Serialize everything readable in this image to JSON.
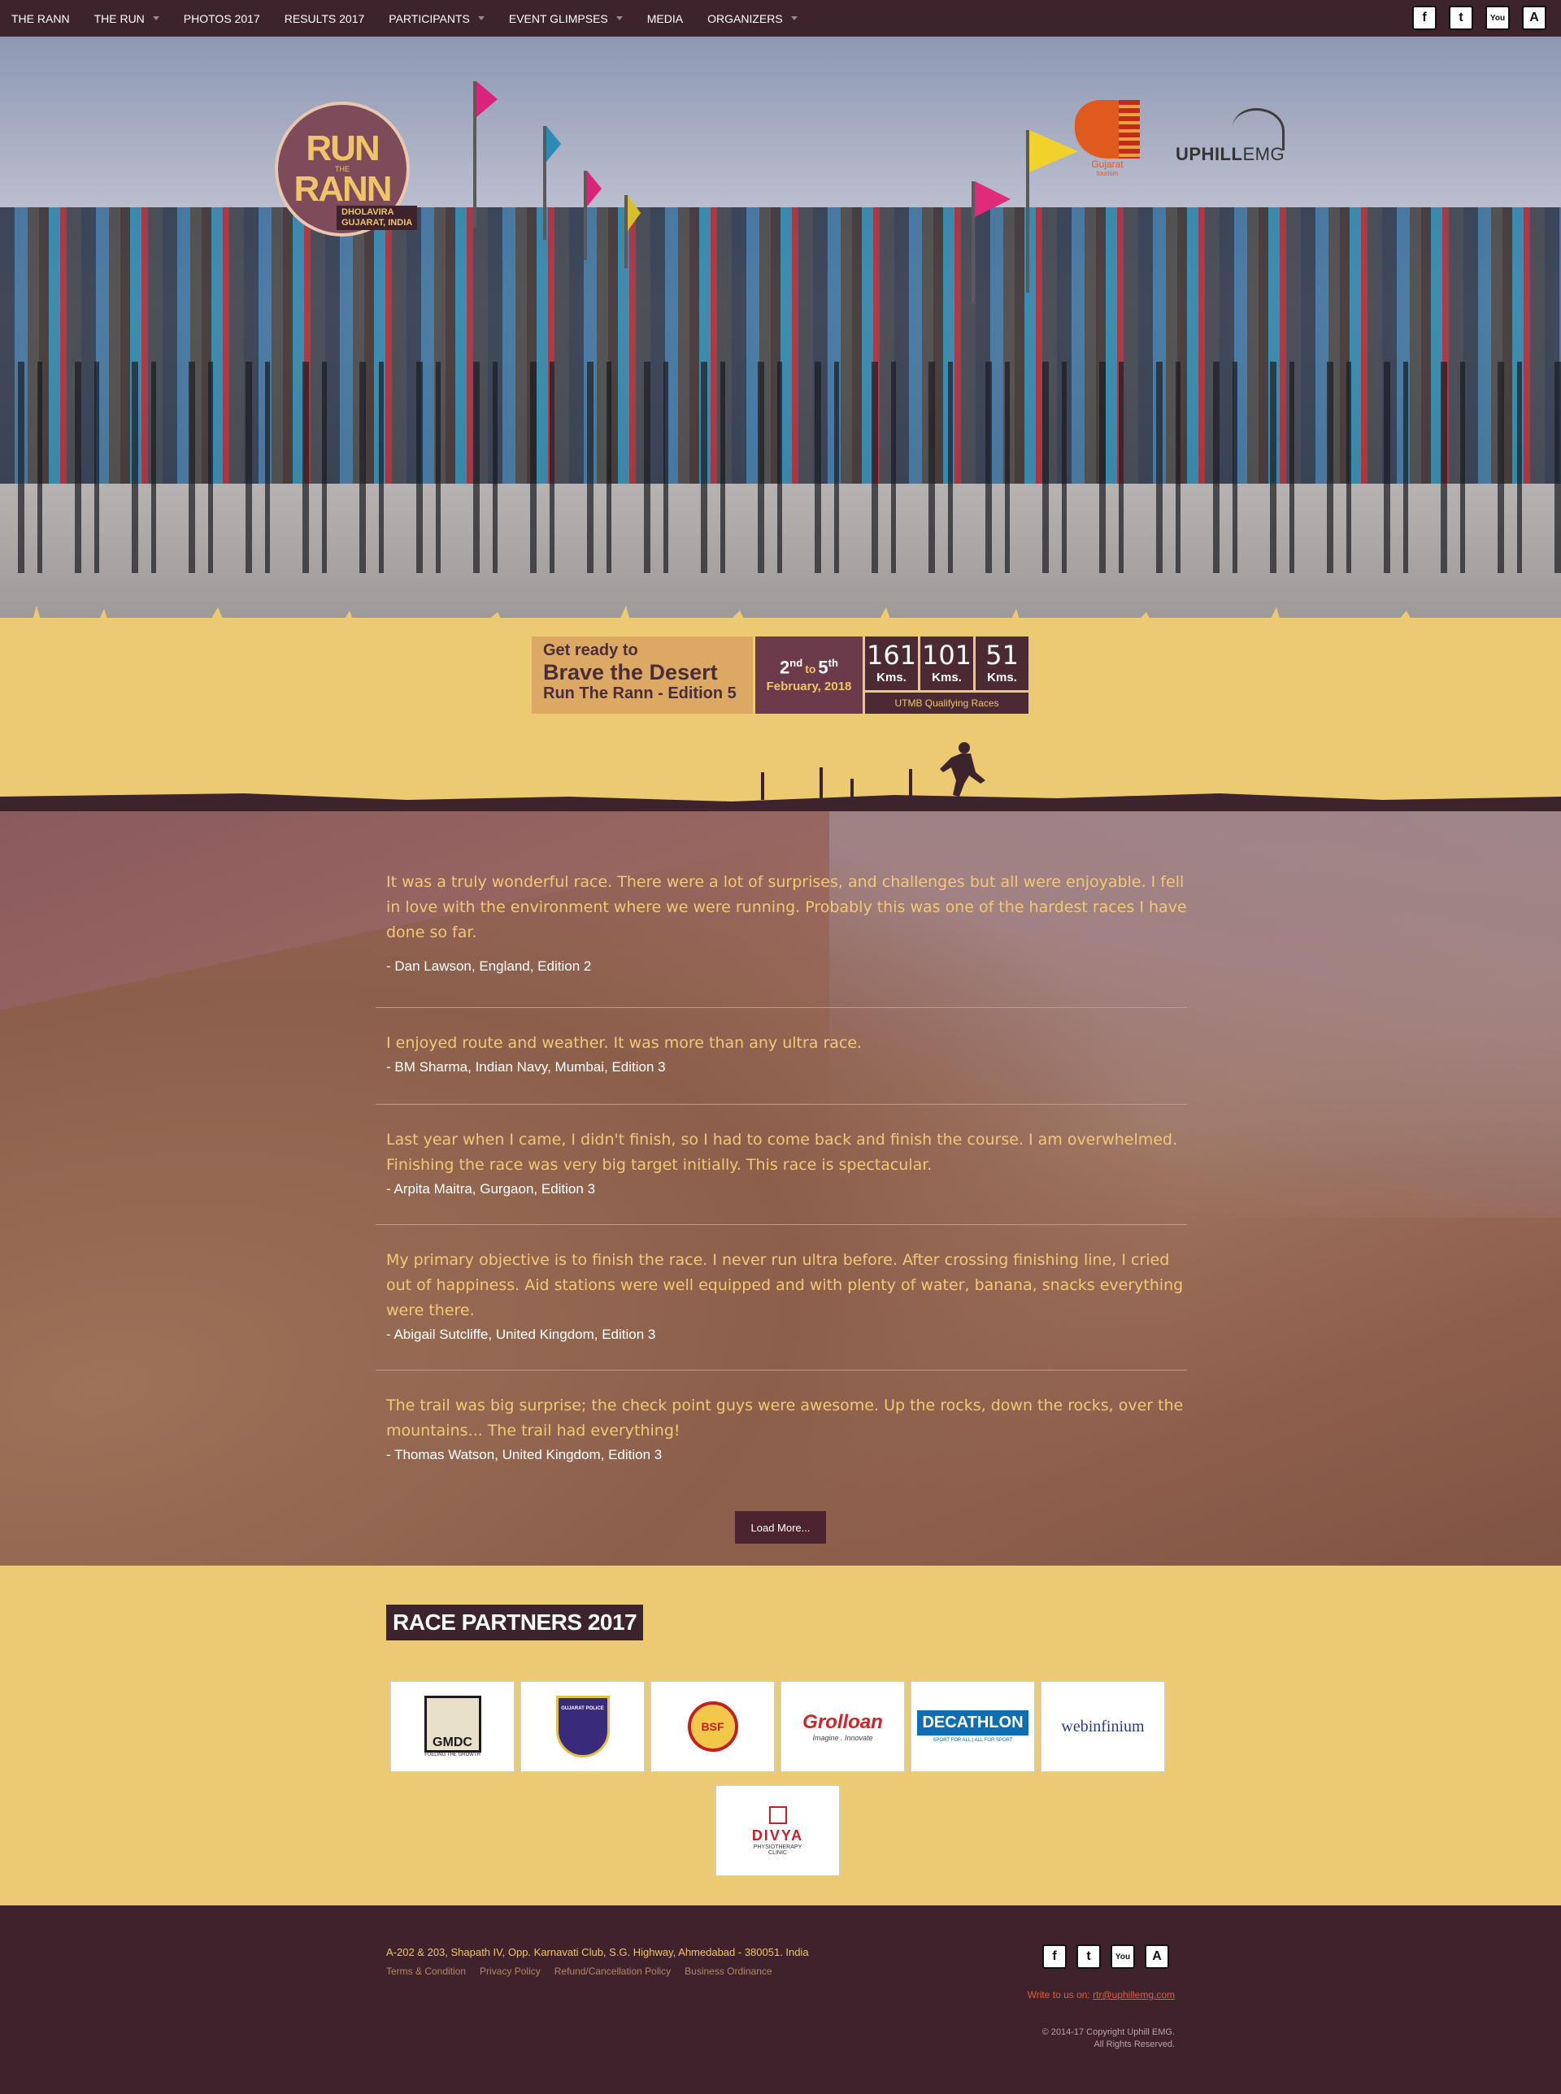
{
  "nav": {
    "items": [
      {
        "label": "THE RANN"
      },
      {
        "label": "THE RUN"
      },
      {
        "label": "PHOTOS 2017"
      },
      {
        "label": "RESULTS 2017"
      },
      {
        "label": "PARTICIPANTS"
      },
      {
        "label": "EVENT GLIMPSES"
      },
      {
        "label": "MEDIA"
      },
      {
        "label": "ORGANIZERS"
      }
    ],
    "social": [
      {
        "icon": "facebook-icon",
        "glyph": "f"
      },
      {
        "icon": "twitter-icon",
        "glyph": "t"
      },
      {
        "icon": "youtube-icon",
        "glyph": "You"
      },
      {
        "icon": "strava-icon",
        "glyph": "A"
      }
    ]
  },
  "hero": {
    "logo_line1": "RUN",
    "logo_the": "THE",
    "logo_line2": "RANN",
    "logo_location1": "DHOLAVIRA",
    "logo_location2": "GUJARAT, INDIA",
    "gujarat_label": "Gujarat",
    "gujarat_sub": "tourism",
    "uphill_bold": "UPHILL",
    "uphill_light": "EMG"
  },
  "info": {
    "get_ready": "Get ready to",
    "brave": "Brave the Desert",
    "edition": "Run The Rann - Edition 5",
    "date_from": "2",
    "date_from_sup": "nd",
    "date_to_word": "to",
    "date_to": "5",
    "date_to_sup": "th",
    "month": "February, 2018",
    "distances": [
      {
        "value": "161",
        "unit": "Kms."
      },
      {
        "value": "101",
        "unit": "Kms."
      },
      {
        "value": "51",
        "unit": "Kms."
      }
    ],
    "utmb": "UTMB Qualifying Races"
  },
  "testimonials": [
    {
      "quote": "It was a truly wonderful race. There were a lot of surprises, and challenges but all were enjoyable. I fell in love with the environment where we were running. Probably this was one of the hardest races I have done so far.",
      "author": "- Dan Lawson, England, Edition 2"
    },
    {
      "quote": "I enjoyed route and weather. It was more than any ultra race.",
      "author": "- BM Sharma, Indian Navy, Mumbai, Edition 3"
    },
    {
      "quote": "Last year when I came, I didn't finish, so I had to come back and finish the course. I am overwhelmed. Finishing the race was very big target initially. This race is spectacular.",
      "author": "- Arpita Maitra, Gurgaon, Edition 3"
    },
    {
      "quote": "My primary objective is to finish the race. I never run ultra before. After crossing finishing line, I cried out of happiness. Aid stations were well equipped and with plenty of water, banana, snacks everything were there.",
      "author": "- Abigail Sutcliffe, United Kingdom, Edition 3"
    },
    {
      "quote": "The trail was big surprise; the check point guys were awesome. Up the rocks, down the rocks, over the mountains... The trail had everything!",
      "author": "- Thomas Watson, United Kingdom, Edition 3"
    }
  ],
  "load_more": "Load More...",
  "partners": {
    "title": "RACE PARTNERS 2017",
    "logos": [
      {
        "name": "GMDC",
        "sub": "FUELING THE GROWTH",
        "color": "#1a1a1a"
      },
      {
        "name": "GUJARAT POLICE",
        "sub": "",
        "color": "#3a2a7a"
      },
      {
        "name": "BSF",
        "sub": "",
        "color": "#c2201f"
      },
      {
        "name": "Grolloan",
        "sub": "Imagine . Innovate",
        "color": "#d3222a"
      },
      {
        "name": "DECATHLON",
        "sub": "SPORT FOR ALL | ALL FOR SPORT",
        "color": "#0f6db3"
      },
      {
        "name": "webinfinium",
        "sub": "",
        "color": "#2a3c8c"
      },
      {
        "name": "DIVYA",
        "sub": "PHYSIOTHERAPY CLINIC",
        "color": "#c8202a"
      }
    ]
  },
  "footer": {
    "address": "A-202 & 203, Shapath IV, Opp. Karnavati Club, S.G. Highway, Ahmedabad - 380051. India",
    "links": [
      "Terms & Condition",
      "Privacy Policy",
      "Refund/Cancellation Policy",
      "Business Ordinance"
    ],
    "write_label": "Write to us on:",
    "email": "rtr@uphillemg.com",
    "copyright1": "© 2014-17 Copyright Uphill EMG.",
    "copyright2": "All Rights Reserved."
  },
  "colors": {
    "nav_bg": "#3d232c",
    "sand": "#ecca72",
    "quote_text": "#f4c777",
    "accent_maroon": "#6b3a4b"
  }
}
